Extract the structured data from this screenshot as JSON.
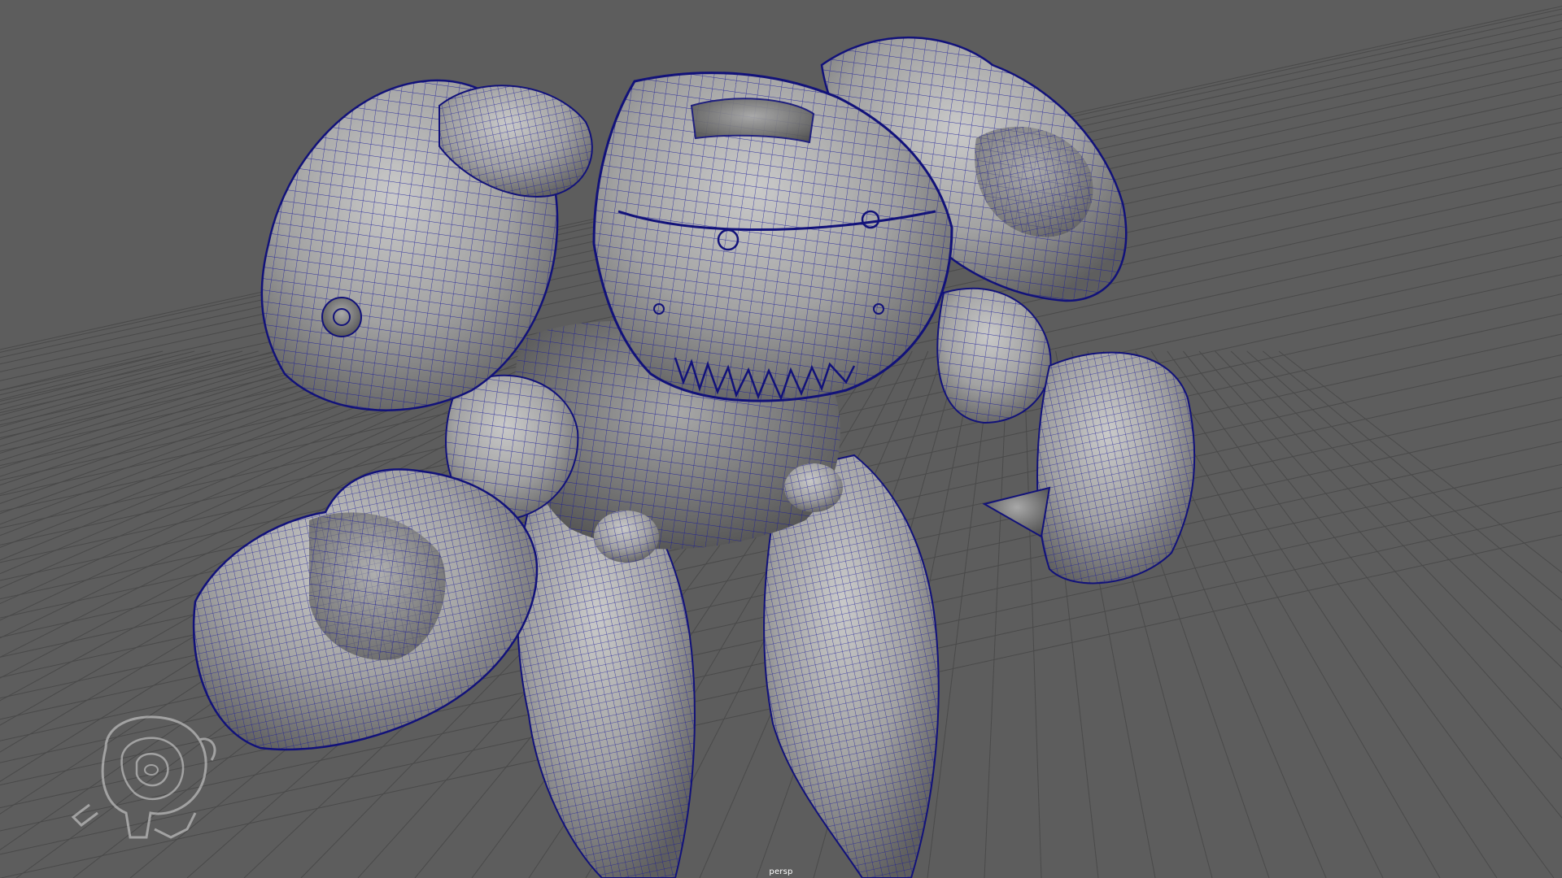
{
  "viewport": {
    "camera_name": "persp",
    "background_color": "#5d5d5d",
    "grid_color": "#4a4a4a",
    "wire_color": "#1a1a9a"
  },
  "scene": {
    "model": "mech-crab-robot-wireframe",
    "logo_icon": "watermark-logo-icon"
  }
}
